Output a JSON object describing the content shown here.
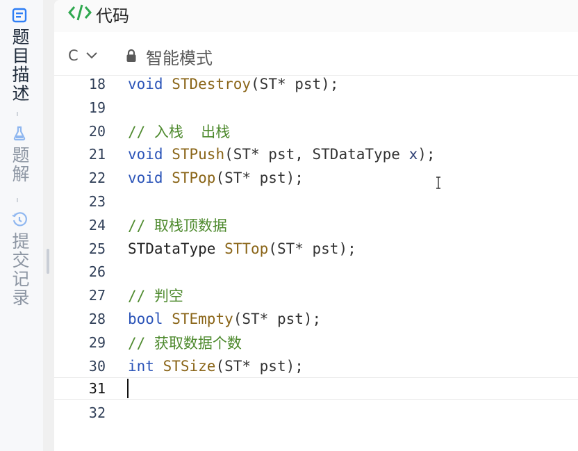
{
  "sidebar": {
    "items": [
      {
        "label": "题目描述",
        "icon": "description-icon",
        "active": true
      },
      {
        "label": "题解",
        "icon": "flask-icon",
        "active": false
      },
      {
        "label": "提交记录",
        "icon": "history-icon",
        "active": false
      }
    ]
  },
  "panel": {
    "title": "代码",
    "title_icon": "code-tag-icon"
  },
  "toolbar": {
    "language": "C",
    "language_dropdown_icon": "chevron-down-icon",
    "mode_icon": "lock-icon",
    "mode_label": "智能模式"
  },
  "editor": {
    "current_line": 31,
    "lines": [
      {
        "no": "18",
        "tokens": [
          {
            "t": "void",
            "k": "kw"
          },
          {
            "t": " ",
            "k": "pn"
          },
          {
            "t": "STDestroy",
            "k": "fn"
          },
          {
            "t": "(ST* pst);",
            "k": "pn"
          }
        ]
      },
      {
        "no": "19",
        "tokens": []
      },
      {
        "no": "20",
        "tokens": [
          {
            "t": "// 入栈  出栈",
            "k": "cm"
          }
        ]
      },
      {
        "no": "21",
        "tokens": [
          {
            "t": "void",
            "k": "kw"
          },
          {
            "t": " ",
            "k": "pn"
          },
          {
            "t": "STPush",
            "k": "fn"
          },
          {
            "t": "(ST* pst, STDataType ",
            "k": "pn"
          },
          {
            "t": "x",
            "k": "param-x"
          },
          {
            "t": ");",
            "k": "pn"
          }
        ]
      },
      {
        "no": "22",
        "tokens": [
          {
            "t": "void",
            "k": "kw"
          },
          {
            "t": " ",
            "k": "pn"
          },
          {
            "t": "STPop",
            "k": "fn"
          },
          {
            "t": "(ST* pst);",
            "k": "pn"
          }
        ]
      },
      {
        "no": "23",
        "tokens": []
      },
      {
        "no": "24",
        "tokens": [
          {
            "t": "// 取栈顶数据",
            "k": "cm"
          }
        ]
      },
      {
        "no": "25",
        "tokens": [
          {
            "t": "STDataType ",
            "k": "ty"
          },
          {
            "t": "STTop",
            "k": "fn"
          },
          {
            "t": "(ST* pst);",
            "k": "pn"
          }
        ]
      },
      {
        "no": "26",
        "tokens": []
      },
      {
        "no": "27",
        "tokens": [
          {
            "t": "// 判空",
            "k": "cm"
          }
        ]
      },
      {
        "no": "28",
        "tokens": [
          {
            "t": "bool",
            "k": "kw"
          },
          {
            "t": " ",
            "k": "pn"
          },
          {
            "t": "STEmpty",
            "k": "fn"
          },
          {
            "t": "(ST* pst);",
            "k": "pn"
          }
        ]
      },
      {
        "no": "29",
        "tokens": [
          {
            "t": "// 获取数据个数",
            "k": "cm"
          }
        ]
      },
      {
        "no": "30",
        "tokens": [
          {
            "t": "int",
            "k": "kw"
          },
          {
            "t": " ",
            "k": "pn"
          },
          {
            "t": "STSize",
            "k": "fn"
          },
          {
            "t": "(ST* pst);",
            "k": "pn"
          }
        ]
      },
      {
        "no": "31",
        "tokens": []
      },
      {
        "no": "32",
        "tokens": []
      }
    ]
  },
  "colors": {
    "keyword": "#2b54b8",
    "function": "#8a6518",
    "comment": "#4e8a2e",
    "accent_blue": "#2f7ef5",
    "code_icon_green": "#2fa84f"
  }
}
